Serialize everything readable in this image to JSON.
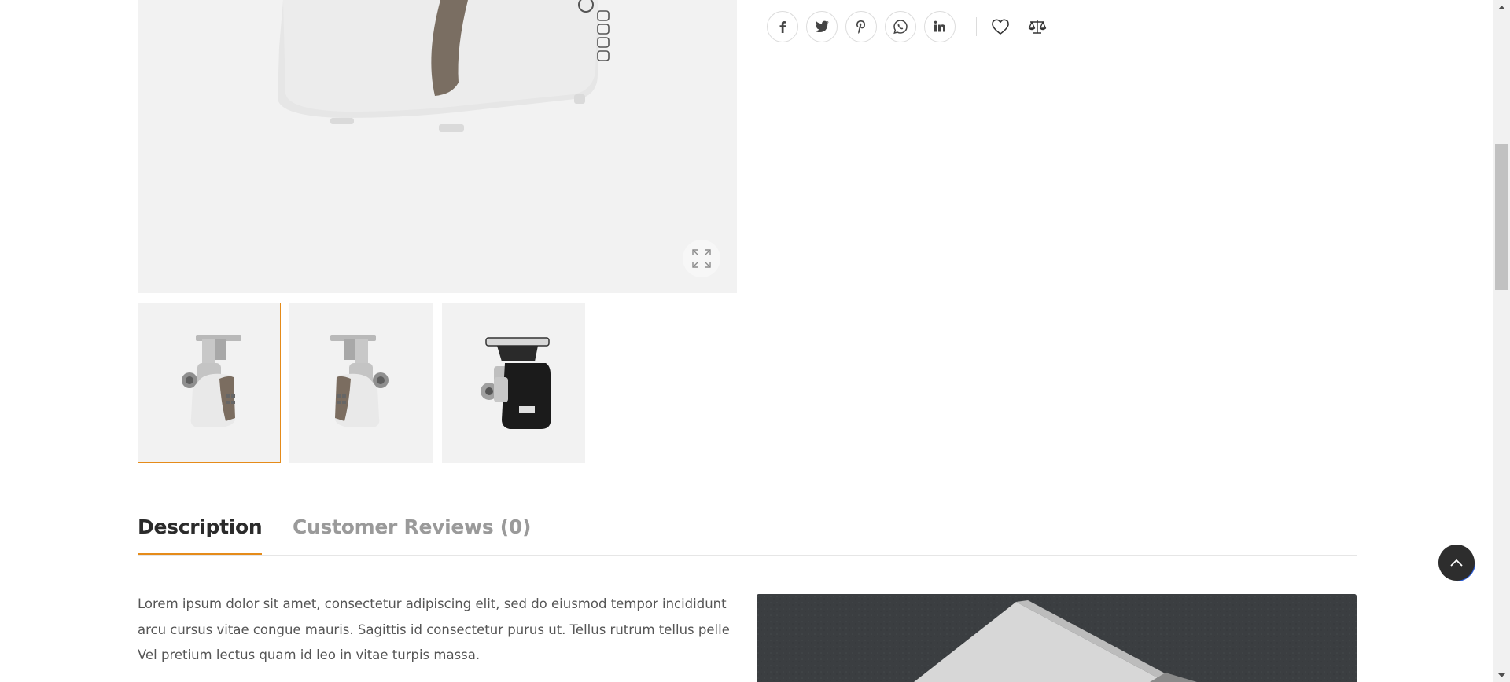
{
  "gallery": {
    "main_image_alt": "meat-grinder-white-main",
    "zoom_icon": "expand-icon",
    "thumbnails": [
      {
        "icon": "meat-grinder-white-thumb",
        "active": true
      },
      {
        "icon": "meat-grinder-white-alt-thumb",
        "active": false
      },
      {
        "icon": "meat-grinder-black-thumb",
        "active": false
      }
    ]
  },
  "share": {
    "social_icons": [
      "facebook-icon",
      "twitter-icon",
      "pinterest-icon",
      "whatsapp-icon",
      "linkedin-icon"
    ],
    "wishlist_icon": "heart-icon",
    "compare_icon": "compare-scale-icon"
  },
  "tabs": [
    {
      "label": "Description",
      "active": true
    },
    {
      "label": "Customer Reviews (0)",
      "active": false
    }
  ],
  "description": {
    "text": "Lorem ipsum dolor sit amet, consectetur adipiscing elit, sed do eiusmod tempor incididunt arcu cursus vitae congue mauris. Sagittis id consectetur purus ut. Tellus rutrum tellus pelle Vel pretium lectus quam id leo in vitae turpis massa."
  },
  "colors": {
    "accent": "#e58b1a",
    "image_bg": "#f2f2f2",
    "back_to_top": "#2d2d2d",
    "progress_ring": "#2a5bd7"
  },
  "back_to_top_icon": "chevron-up-icon"
}
